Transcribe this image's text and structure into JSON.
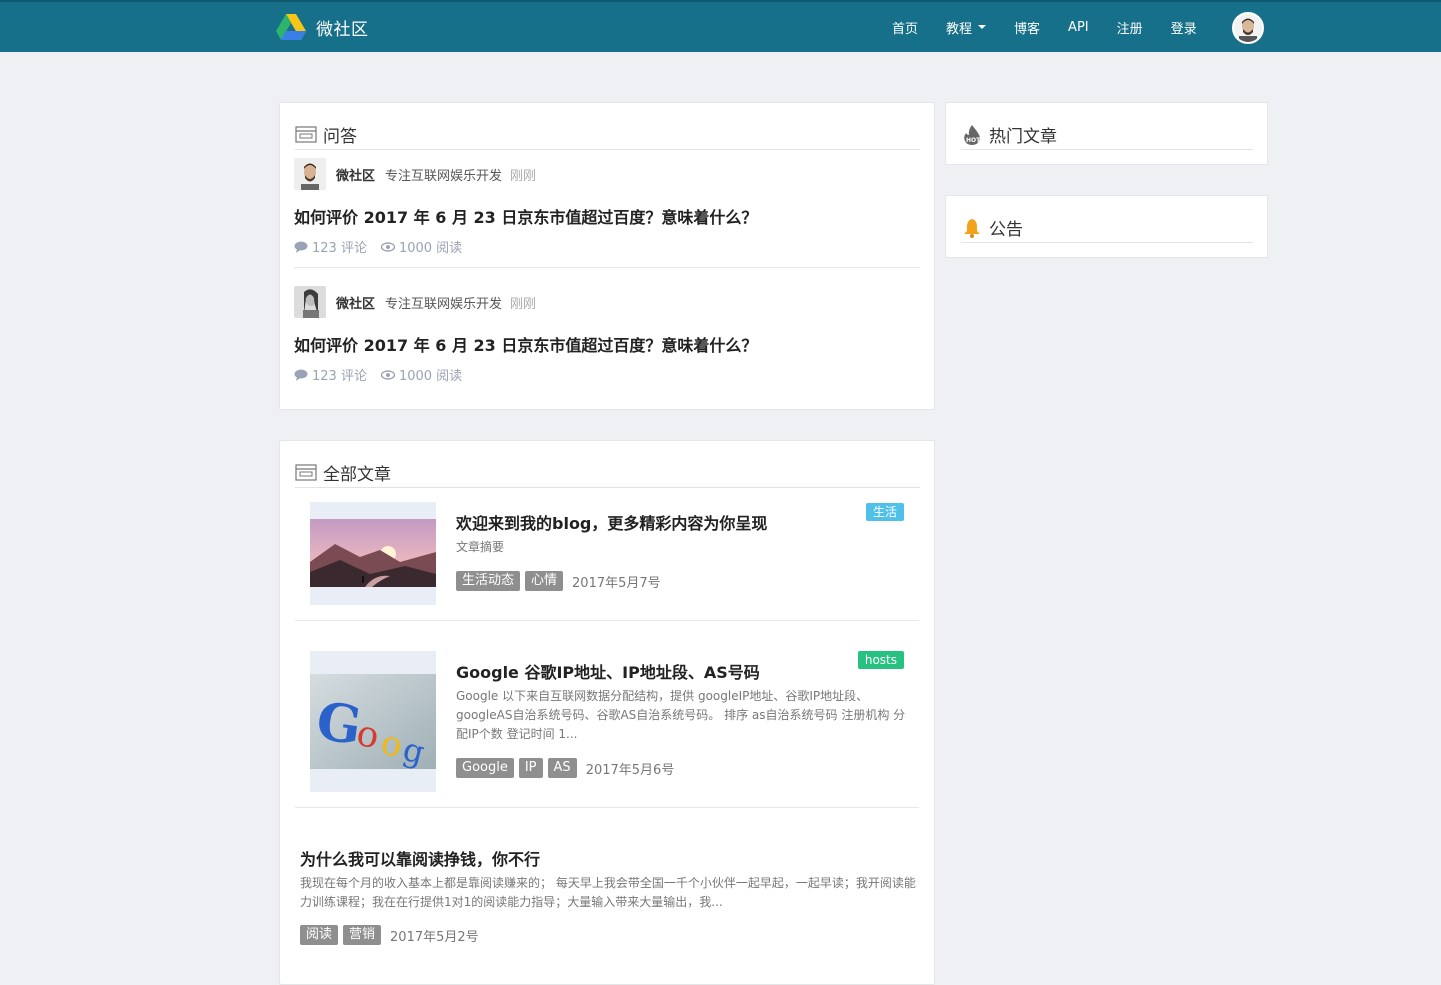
{
  "header": {
    "brand": "微社区",
    "nav": [
      {
        "label": "首页"
      },
      {
        "label": "教程",
        "dropdown": true
      },
      {
        "label": "博客"
      },
      {
        "label": "API"
      },
      {
        "label": "注册"
      },
      {
        "label": "登录"
      }
    ]
  },
  "qa": {
    "title": "问答",
    "items": [
      {
        "author": "微社区",
        "desc": "专注互联网娱乐开发",
        "time": "刚刚",
        "title": "如何评价 2017 年 6 月 23 日京东市值超过百度？意味着什么？",
        "comments": "123 评论",
        "views": "1000 阅读"
      },
      {
        "author": "微社区",
        "desc": "专注互联网娱乐开发",
        "time": "刚刚",
        "title": "如何评价 2017 年 6 月 23 日京东市值超过百度？意味着什么？",
        "comments": "123 评论",
        "views": "1000 阅读"
      }
    ]
  },
  "articles": {
    "title": "全部文章",
    "items": [
      {
        "title": "欢迎来到我的blog，更多精彩内容为你呈现",
        "summary": "文章摘要",
        "badge": "生活",
        "badge_color": "#4fc1e9",
        "tags": [
          "生活动态",
          "心情"
        ],
        "date": "2017年5月7号"
      },
      {
        "title": "Google 谷歌IP地址、IP地址段、AS号码",
        "summary": "Google 以下来自互联网数据分配结构，提供 googleIP地址、谷歌IP地址段、googleAS自治系统号码、谷歌AS自治系统号码。 排序 as自治系统号码 注册机构 分配IP个数 登记时间 1...",
        "badge": "hosts",
        "badge_color": "#27c281",
        "tags": [
          "Google",
          "IP",
          "AS"
        ],
        "date": "2017年5月6号"
      },
      {
        "title": "为什么我可以靠阅读挣钱，你不行",
        "summary": "我现在每个月的收入基本上都是靠阅读赚来的； 每天早上我会带全国一千个小伙伴一起早起，一起早读；我开阅读能力训练课程；我在在行提供1对1的阅读能力指导；大量输入带来大量输出，我...",
        "tags": [
          "阅读",
          "营销"
        ],
        "date": "2017年5月2号"
      }
    ]
  },
  "sidebar": {
    "hot_title": "热门文章",
    "notice_title": "公告"
  },
  "colors": {
    "header": "#177089",
    "background": "#eef0f3"
  }
}
